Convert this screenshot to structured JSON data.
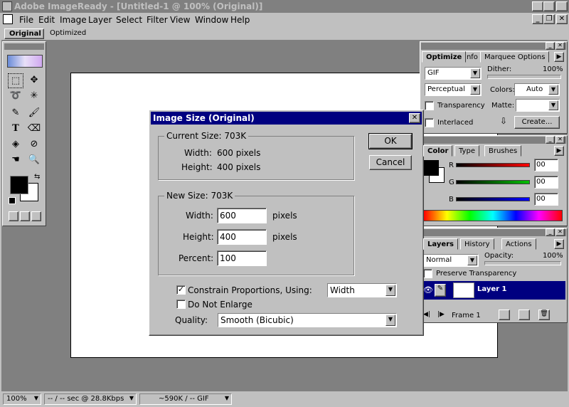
{
  "app": {
    "title": "Adobe ImageReady - [Untitled-1 @ 100% (Original)]",
    "menu": [
      "File",
      "Edit",
      "Image",
      "Layer",
      "Select",
      "Filter",
      "View",
      "Window",
      "Help"
    ],
    "doc_tabs": [
      "Original",
      "Optimized"
    ]
  },
  "optimize": {
    "tabs": [
      "Optimize",
      "Info",
      "Marquee Options"
    ],
    "format": "GIF",
    "dither_label": "Dither:",
    "dither_value": "100%",
    "palette": "Perceptual",
    "colors_label": "Colors:",
    "colors_value": "Auto",
    "transparency_label": "Transparency",
    "matte_label": "Matte:",
    "interlaced_label": "Interlaced",
    "create_label": "Create..."
  },
  "color": {
    "tabs": [
      "Color",
      "Type",
      "Brushes"
    ],
    "r_label": "R",
    "r_value": "00",
    "g_label": "G",
    "g_value": "00",
    "b_label": "B",
    "b_value": "00",
    "colors": {
      "red": "#ff0000",
      "green": "#00c000",
      "blue": "#0000ff"
    }
  },
  "layers": {
    "tabs": [
      "Layers",
      "History",
      "Actions"
    ],
    "mode": "Normal",
    "opacity_label": "Opacity:",
    "opacity_value": "100%",
    "preserve_label": "Preserve Transparency",
    "layer_name": "Layer 1",
    "frame_label": "Frame 1"
  },
  "dialog": {
    "title": "Image Size (Original)",
    "current_size_label": "Current Size:",
    "current_size_value": "703K",
    "width_label": "Width:",
    "width_value": "600 pixels",
    "height_label": "Height:",
    "height_value": "400 pixels",
    "new_size_label": "New Size:",
    "new_size_value": "703K",
    "new_width_label": "Width:",
    "new_width_value": "600",
    "new_height_label": "Height:",
    "new_height_value": "400",
    "percent_label": "Percent:",
    "percent_value": "100",
    "unit": "pixels",
    "constrain_label": "Constrain Proportions, Using:",
    "constrain_checked": true,
    "constrain_option": "Width",
    "no_enlarge_label": "Do Not Enlarge",
    "quality_label": "Quality:",
    "quality_value": "Smooth (Bicubic)",
    "ok_label": "OK",
    "cancel_label": "Cancel"
  },
  "status": {
    "zoom": "100%",
    "download": "-- / -- sec @ 28.8Kbps",
    "size": "~590K / -- GIF"
  }
}
